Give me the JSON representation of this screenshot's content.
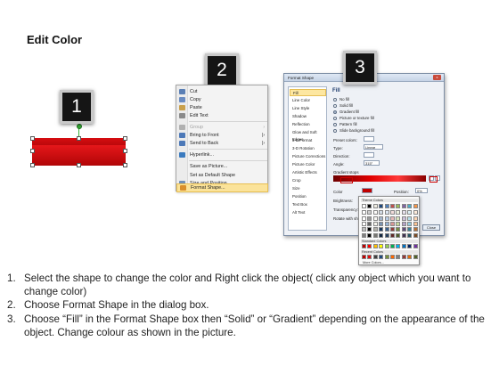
{
  "title": "Edit Color",
  "badges": [
    "1",
    "2",
    "3"
  ],
  "context_menu": {
    "items": [
      {
        "label": "Cut",
        "icon": "scissors-icon",
        "color": "#5a7fb5"
      },
      {
        "label": "Copy",
        "icon": "copy-icon",
        "color": "#6a8cc2"
      },
      {
        "label": "Paste",
        "icon": "paste-icon",
        "color": "#c9a04b"
      },
      {
        "label": "Edit Text",
        "icon": "edit-text-icon",
        "color": "#8a8a8a"
      },
      {
        "label": "Group",
        "icon": "group-icon",
        "color": "#b0b0b0"
      },
      {
        "label": "Bring to Front",
        "icon": "bring-front-icon",
        "color": "#4d79b8"
      },
      {
        "label": "Send to Back",
        "icon": "send-back-icon",
        "color": "#4d79b8"
      },
      {
        "label": "Hyperlink...",
        "icon": "hyperlink-icon",
        "color": "#3b7bbf"
      },
      {
        "label": "Save as Picture...",
        "icon": "save-picture-icon",
        "color": ""
      },
      {
        "label": "Set as Default Shape",
        "icon": "default-shape-icon",
        "color": ""
      },
      {
        "label": "Size and Position...",
        "icon": "size-position-icon",
        "color": "#6f8fb8"
      },
      {
        "label": "Format Shape...",
        "icon": "format-shape-icon",
        "color": "#d98f2b"
      }
    ]
  },
  "dialog": {
    "title": "Format Shape",
    "close": "x",
    "nav": [
      "Fill",
      "Line Color",
      "Line Style",
      "Shadow",
      "Reflection",
      "Glow and Soft Edges",
      "3-D Format",
      "3-D Rotation",
      "Picture Corrections",
      "Picture Color",
      "Artistic Effects",
      "Crop",
      "Size",
      "Position",
      "Text Box",
      "Alt Text"
    ],
    "fill_heading": "Fill",
    "options": [
      "No fill",
      "Solid fill",
      "Gradient fill",
      "Picture or texture fill",
      "Pattern fill",
      "Slide background fill"
    ],
    "fields": {
      "preset": "Preset colors:",
      "type": "Type:",
      "type_value": "Linear",
      "direction": "Direction:",
      "angle": "Angle:",
      "angle_value": "315°",
      "stops": "Gradient stops",
      "color": "Color",
      "position": "Position:",
      "position_value": "0%",
      "brightness": "Brightness:",
      "transparency": "Transparency:",
      "rotate": "Rotate with shape"
    },
    "close_button": "Close"
  },
  "picker": {
    "theme_title": "Theme Colors",
    "standard_title": "Standard Colors",
    "recent_title": "Recent Colors",
    "more": "More Colors...",
    "theme_top": [
      "#ffffff",
      "#000000",
      "#eeece1",
      "#1f497d",
      "#4f81bd",
      "#c0504d",
      "#9bbb59",
      "#8064a2",
      "#4bacc6",
      "#f79646"
    ],
    "standard": [
      "#c00000",
      "#ff0000",
      "#ffc000",
      "#ffff00",
      "#92d050",
      "#00b050",
      "#00b0f0",
      "#0070c0",
      "#002060",
      "#7030a0"
    ],
    "recent": [
      "#c00000",
      "#e01010",
      "#404040",
      "#1f497d",
      "#76923c",
      "#ff6600",
      "#7f7f7f",
      "#953734",
      "#e36c09",
      "#4f6228"
    ]
  },
  "instructions": [
    {
      "num": "1.",
      "text": "Select the shape to change the color and Right click the object( click any object which you want to change color)"
    },
    {
      "num": "2.",
      "text": "Choose Format Shape in the dialog box."
    },
    {
      "num": "3.",
      "text": "Choose “Fill” in the Format Shape box then “Solid” or “Gradient” depending on the appearance of the object. Change colour as shown in the picture."
    }
  ]
}
